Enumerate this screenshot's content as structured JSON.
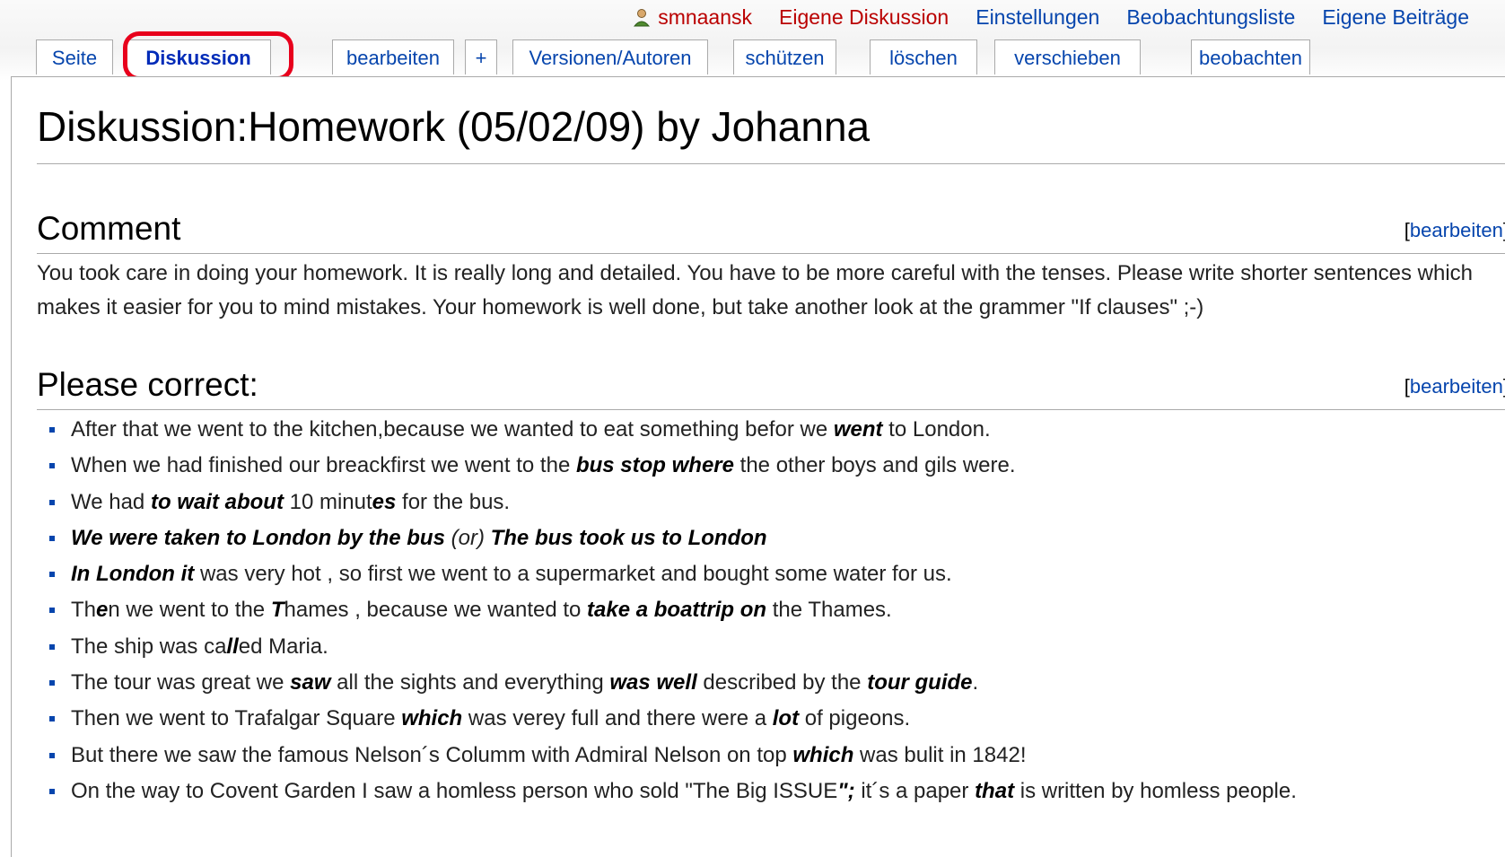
{
  "personal": {
    "user": "smnaansk",
    "talk": "Eigene Diskussion",
    "prefs": "Einstellungen",
    "watchlist": "Beobachtungsliste",
    "contribs": "Eigene Beiträge"
  },
  "tabs": {
    "page": "Seite",
    "discussion": "Diskussion",
    "edit": "bearbeiten",
    "new_section": "+",
    "history": "Versionen/Autoren",
    "protect": "schützen",
    "delete": "löschen",
    "move": "verschieben",
    "watch": "beobachten"
  },
  "title": "Diskussion:Homework (05/02/09) by Johanna",
  "sections": {
    "comment": {
      "heading": "Comment",
      "edit_open": "[",
      "edit_label": "bearbeiten",
      "edit_close": "]",
      "text": "You took care in doing your homework. It is really long and detailed. You have to be more careful with the tenses. Please write shorter sentences which makes it easier for you to mind mistakes. Your homework is well done, but take another look at the grammer \"If clauses\" ;-)"
    },
    "correct": {
      "heading": "Please correct:",
      "edit_open": "[",
      "edit_label": "bearbeiten",
      "edit_close": "]"
    }
  },
  "corrections": [
    [
      {
        "t": "After that we went to the kitchen,because we wanted to eat something befor we "
      },
      {
        "t": "went",
        "b": true
      },
      {
        "t": " to London."
      }
    ],
    [
      {
        "t": "When we had finished our breackfirst we went to the "
      },
      {
        "t": "bus stop where",
        "b": true
      },
      {
        "t": " the other boys and gils were."
      }
    ],
    [
      {
        "t": "We had "
      },
      {
        "t": "to wait about",
        "b": true
      },
      {
        "t": " 10 minut"
      },
      {
        "t": "es",
        "b": true
      },
      {
        "t": " for the bus."
      }
    ],
    [
      {
        "t": "We were taken to London by the bus",
        "b": true
      },
      {
        "t": " (or) ",
        "i": true
      },
      {
        "t": "The bus took us to London",
        "b": true
      }
    ],
    [
      {
        "t": "In London it",
        "b": true
      },
      {
        "t": " was very hot , so first we went to a supermarket and bought some water for us."
      }
    ],
    [
      {
        "t": "Th"
      },
      {
        "t": "e",
        "b": true
      },
      {
        "t": "n we went to the "
      },
      {
        "t": "T",
        "b": true
      },
      {
        "t": "hames , because we wanted to "
      },
      {
        "t": "take a boattrip on",
        "b": true
      },
      {
        "t": " the Thames."
      }
    ],
    [
      {
        "t": "The ship was ca"
      },
      {
        "t": "ll",
        "b": true
      },
      {
        "t": "ed Maria."
      }
    ],
    [
      {
        "t": "The tour was great we "
      },
      {
        "t": "saw",
        "b": true
      },
      {
        "t": " all the sights and everything "
      },
      {
        "t": "was well",
        "b": true
      },
      {
        "t": " described by the "
      },
      {
        "t": "tour guide",
        "b": true
      },
      {
        "t": "."
      }
    ],
    [
      {
        "t": "Then we went to Trafalgar Square "
      },
      {
        "t": "which",
        "b": true
      },
      {
        "t": " was verey full and there were a "
      },
      {
        "t": "lot",
        "b": true
      },
      {
        "t": " of pigeons."
      }
    ],
    [
      {
        "t": "But there we saw the famous Nelson´s Columm with Admiral Nelson on top "
      },
      {
        "t": "which",
        "b": true
      },
      {
        "t": " was bulit in 1842!"
      }
    ],
    [
      {
        "t": "On the way to Covent Garden I saw a homless person who sold \"The Big ISSUE"
      },
      {
        "t": "\";",
        "b": true
      },
      {
        "t": " it´s a paper "
      },
      {
        "t": "that",
        "b": true
      },
      {
        "t": " is written by homless people."
      }
    ]
  ]
}
